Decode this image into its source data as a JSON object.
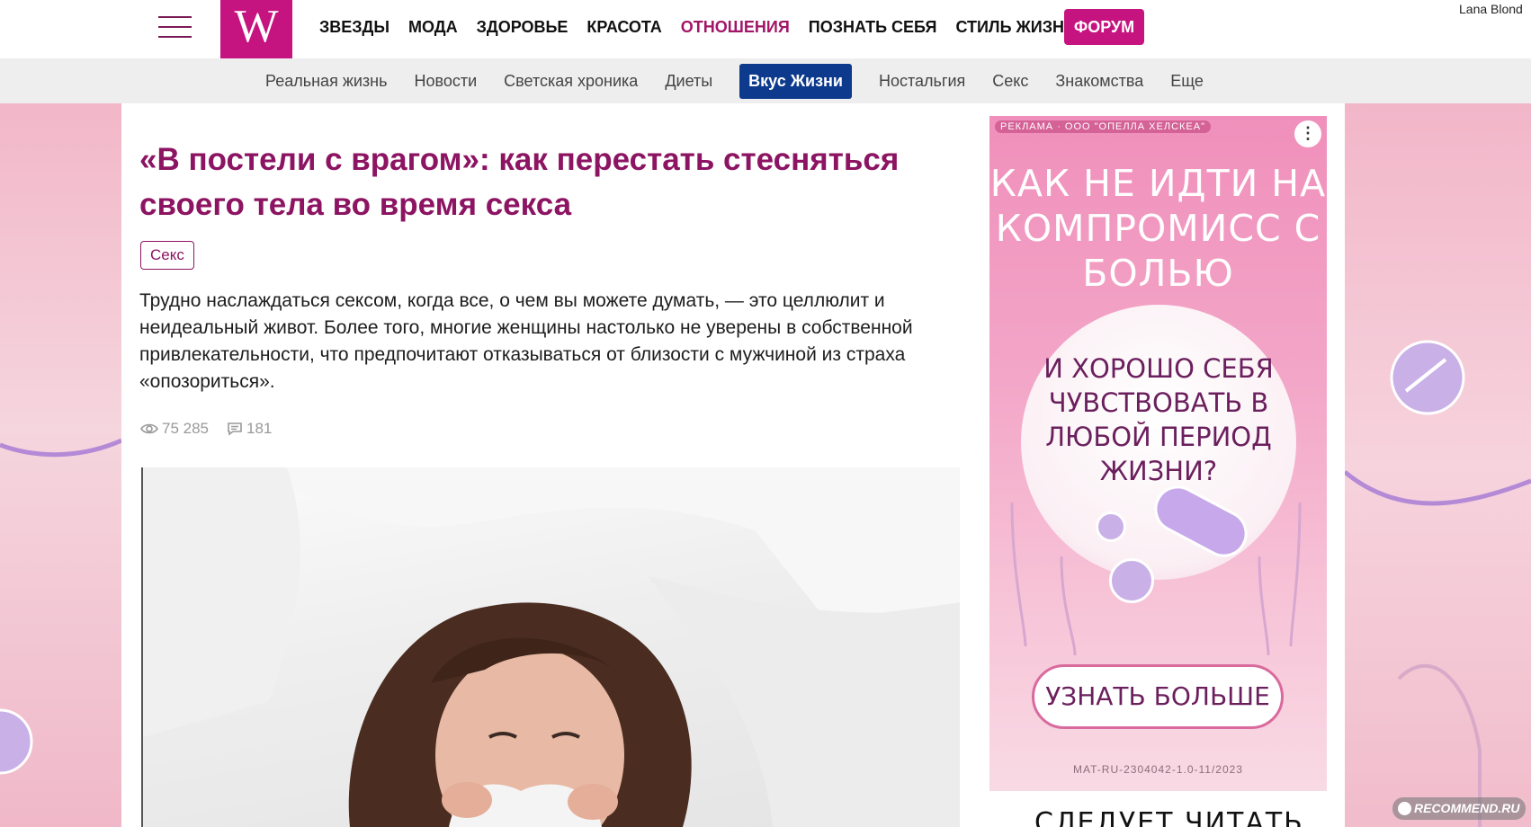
{
  "header": {
    "logo_text": "W",
    "main_nav": [
      {
        "label": "ЗВЕЗДЫ",
        "active": false
      },
      {
        "label": "МОДА",
        "active": false
      },
      {
        "label": "ЗДОРОВЬЕ",
        "active": false
      },
      {
        "label": "КРАСОТА",
        "active": false
      },
      {
        "label": "ОТНОШЕНИЯ",
        "active": true
      },
      {
        "label": "ПОЗНАТЬ СЕБЯ",
        "active": false
      },
      {
        "label": "СТИЛЬ ЖИЗНИ",
        "active": false
      }
    ],
    "forum_label": "ФОРУМ",
    "user_name": "Lana Blond"
  },
  "subnav": {
    "items": [
      "Реальная жизнь",
      "Новости",
      "Светская хроника",
      "Диеты",
      "Вкус Жизни",
      "Ностальгия",
      "Секс",
      "Знакомства",
      "Еще"
    ],
    "active_item": "Вкус Жизни"
  },
  "article": {
    "title": "«В постели с врагом»: как перестать стесняться своего тела во время секса",
    "tag": "Секс",
    "lead": "Трудно наслаждаться сексом, когда все, о чем вы можете думать, — это целлюлит и неидеальный живот. Более того, многие женщины настолько не уверены в собственной привлекательности, что предпочитают отказываться от близости с мужчиной из страха «опозориться».",
    "views": "75 285",
    "comments": "181"
  },
  "ad": {
    "label": "РЕКЛАМА · ООО \"ОПЕЛЛА ХЕЛСКЕА\"",
    "menu_icon": "more-vertical-icon",
    "headline": "КАК НЕ ИДТИ НА КОМПРОМИСС С БОЛЬЮ",
    "body": "И ХОРОШО СЕБЯ ЧУВСТВОВАТЬ В ЛЮБОЙ ПЕРИОД ЖИЗНИ?",
    "cta": "УЗНАТЬ БОЛЬШЕ",
    "code": "MAT-RU-2304042-1.0-11/2023"
  },
  "sidebar_next_heading": "СЛЕДУЕТ ЧИТАТЬ",
  "watermark": "RECOMMEND.RU",
  "colors": {
    "brand": "#c5137f",
    "title": "#8c1462",
    "active_pill": "#0d3a8c"
  }
}
